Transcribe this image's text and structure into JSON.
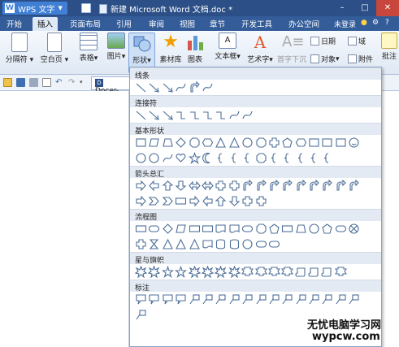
{
  "titlebar": {
    "app_name": "WPS 文字",
    "document_title": "新建 Microsoft Word 文档.doc *"
  },
  "menubar": {
    "tabs": [
      "开始",
      "插入",
      "页面布局",
      "引用",
      "审阅",
      "视图",
      "章节",
      "开发工具",
      "办公空间"
    ],
    "login": "未登录"
  },
  "ribbon": {
    "page_break": "分隔符",
    "blank_page": "空白页",
    "table": "表格",
    "picture": "图片",
    "shapes": "形状",
    "clipart": "素材库",
    "chart": "图表",
    "textbox": "文本框",
    "wordart": "艺术字",
    "vertical_text": "首字下沉",
    "date": "日期",
    "field": "域",
    "object": "对象",
    "attachment": "附件",
    "comment": "批注"
  },
  "toolbar2": {
    "doc_tab": "Docer-"
  },
  "shapes_panel": {
    "sections": [
      {
        "title": "线条",
        "count": 6
      },
      {
        "title": "连接符",
        "count": 9
      },
      {
        "title": "基本形状",
        "count": 32
      },
      {
        "title": "箭头总汇",
        "count": 27
      },
      {
        "title": "流程图",
        "count": 28
      },
      {
        "title": "星与旗帜",
        "count": 16
      },
      {
        "title": "标注",
        "count": 18
      }
    ]
  },
  "watermark": {
    "line1": "无忧电脑学习网",
    "line2": "wypcw.com"
  }
}
